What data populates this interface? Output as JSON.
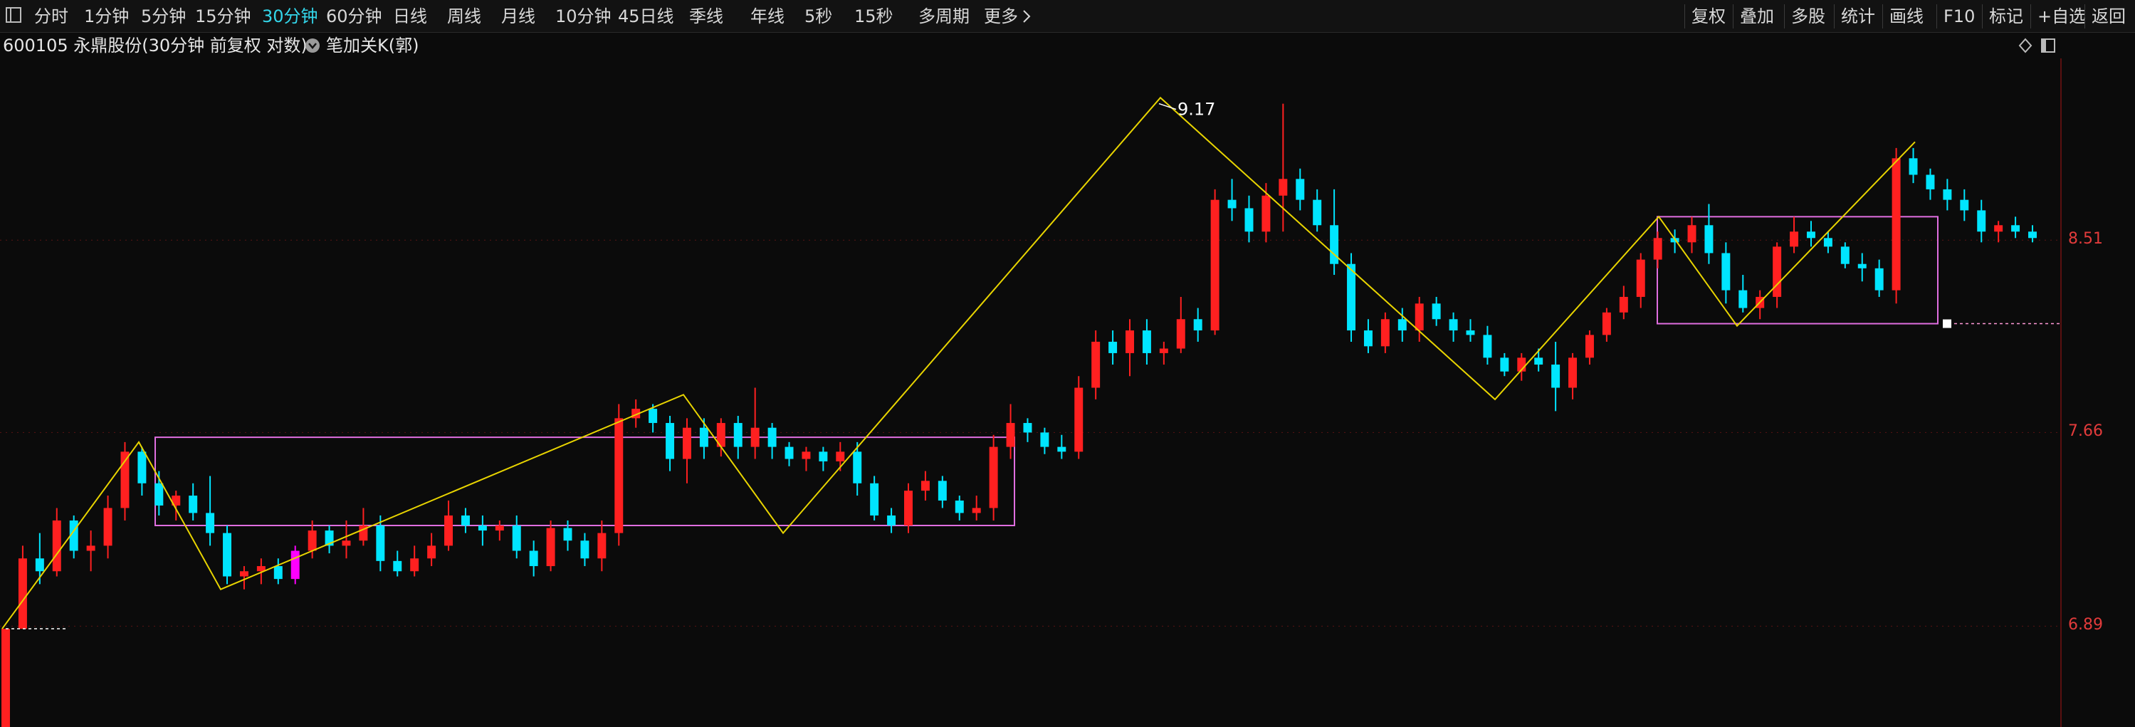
{
  "toolbar": {
    "left_items": [
      "分时",
      "1分钟",
      "5分钟",
      "15分钟",
      "30分钟",
      "60分钟",
      "日线",
      "周线",
      "月线",
      "10分钟",
      "45日线",
      "季线",
      "年线",
      "5秒",
      "15秒",
      "多周期",
      "更多"
    ],
    "active_index": 4,
    "more_chevron": "chevron-right-icon",
    "right_items": [
      "复权",
      "叠加",
      "多股",
      "统计",
      "画线",
      "F10",
      "标记",
      "+自选",
      "返回"
    ]
  },
  "infobar": {
    "stock_title": "600105 永鼎股份(30分钟 前复权 对数)",
    "indicator_label": "笔加关K(郭)",
    "indicator_icon": "chevron-down-circle-icon",
    "diamond_icon": "diamond-icon",
    "window_icon": "window-icon"
  },
  "colors": {
    "accent": "#33d6ea",
    "up": "#ff2020",
    "down": "#00e5ff",
    "stroke_line": "#e8d400",
    "pivot_box": "#e06ee0",
    "axis_label": "#e23b3b",
    "highlight": "#ff00ff"
  },
  "chart_data": {
    "type": "candlestick",
    "y_scale": "log",
    "ylim": [
      6.52,
      9.4
    ],
    "y_ticks": [
      {
        "label": "8.51",
        "value": 8.51
      },
      {
        "label": "7.66",
        "value": 7.66
      },
      {
        "label": "6.89",
        "value": 6.89
      }
    ],
    "peak_label": {
      "text": "9.17",
      "value": 9.17
    },
    "last_price": 8.13,
    "candles": [
      [
        6.5,
        6.88,
        6.5,
        6.88
      ],
      [
        6.88,
        7.2,
        6.88,
        7.15
      ],
      [
        7.15,
        7.25,
        7.05,
        7.1
      ],
      [
        7.1,
        7.35,
        7.08,
        7.3
      ],
      [
        7.3,
        7.32,
        7.15,
        7.18
      ],
      [
        7.18,
        7.26,
        7.1,
        7.2
      ],
      [
        7.2,
        7.4,
        7.15,
        7.35
      ],
      [
        7.35,
        7.62,
        7.3,
        7.58
      ],
      [
        7.58,
        7.6,
        7.4,
        7.45
      ],
      [
        7.45,
        7.5,
        7.32,
        7.36
      ],
      [
        7.36,
        7.42,
        7.3,
        7.4
      ],
      [
        7.4,
        7.45,
        7.3,
        7.33
      ],
      [
        7.33,
        7.48,
        7.2,
        7.25
      ],
      [
        7.25,
        7.28,
        7.05,
        7.08
      ],
      [
        7.08,
        7.12,
        7.03,
        7.1
      ],
      [
        7.1,
        7.15,
        7.05,
        7.12
      ],
      [
        7.12,
        7.15,
        7.05,
        7.07
      ],
      [
        7.07,
        7.2,
        7.05,
        7.18
      ],
      [
        7.18,
        7.3,
        7.15,
        7.26
      ],
      [
        7.26,
        7.28,
        7.17,
        7.2
      ],
      [
        7.2,
        7.3,
        7.15,
        7.22
      ],
      [
        7.22,
        7.35,
        7.2,
        7.28
      ],
      [
        7.28,
        7.32,
        7.1,
        7.14
      ],
      [
        7.14,
        7.18,
        7.08,
        7.1
      ],
      [
        7.1,
        7.2,
        7.08,
        7.15
      ],
      [
        7.15,
        7.25,
        7.12,
        7.2
      ],
      [
        7.2,
        7.38,
        7.18,
        7.32
      ],
      [
        7.32,
        7.35,
        7.25,
        7.28
      ],
      [
        7.28,
        7.32,
        7.2,
        7.26
      ],
      [
        7.26,
        7.3,
        7.22,
        7.28
      ],
      [
        7.28,
        7.32,
        7.15,
        7.18
      ],
      [
        7.18,
        7.22,
        7.08,
        7.12
      ],
      [
        7.12,
        7.3,
        7.1,
        7.27
      ],
      [
        7.27,
        7.3,
        7.18,
        7.22
      ],
      [
        7.22,
        7.25,
        7.12,
        7.15
      ],
      [
        7.15,
        7.3,
        7.1,
        7.25
      ],
      [
        7.25,
        7.78,
        7.2,
        7.72
      ],
      [
        7.72,
        7.8,
        7.68,
        7.76
      ],
      [
        7.76,
        7.78,
        7.66,
        7.7
      ],
      [
        7.7,
        7.73,
        7.5,
        7.55
      ],
      [
        7.55,
        7.72,
        7.45,
        7.68
      ],
      [
        7.68,
        7.72,
        7.55,
        7.6
      ],
      [
        7.6,
        7.72,
        7.56,
        7.7
      ],
      [
        7.7,
        7.73,
        7.55,
        7.6
      ],
      [
        7.6,
        7.85,
        7.55,
        7.68
      ],
      [
        7.68,
        7.7,
        7.55,
        7.6
      ],
      [
        7.6,
        7.62,
        7.52,
        7.55
      ],
      [
        7.55,
        7.6,
        7.5,
        7.58
      ],
      [
        7.58,
        7.6,
        7.5,
        7.54
      ],
      [
        7.54,
        7.62,
        7.5,
        7.58
      ],
      [
        7.58,
        7.62,
        7.4,
        7.45
      ],
      [
        7.45,
        7.48,
        7.3,
        7.32
      ],
      [
        7.32,
        7.35,
        7.25,
        7.28
      ],
      [
        7.28,
        7.45,
        7.25,
        7.42
      ],
      [
        7.42,
        7.5,
        7.38,
        7.46
      ],
      [
        7.46,
        7.48,
        7.35,
        7.38
      ],
      [
        7.38,
        7.4,
        7.3,
        7.33
      ],
      [
        7.33,
        7.4,
        7.3,
        7.35
      ],
      [
        7.35,
        7.65,
        7.3,
        7.6
      ],
      [
        7.6,
        7.78,
        7.55,
        7.7
      ],
      [
        7.7,
        7.72,
        7.62,
        7.66
      ],
      [
        7.66,
        7.68,
        7.57,
        7.6
      ],
      [
        7.6,
        7.65,
        7.55,
        7.58
      ],
      [
        7.58,
        7.9,
        7.55,
        7.85
      ],
      [
        7.85,
        8.1,
        7.8,
        8.05
      ],
      [
        8.05,
        8.1,
        7.95,
        8.0
      ],
      [
        8.0,
        8.15,
        7.9,
        8.1
      ],
      [
        8.1,
        8.15,
        7.95,
        8.0
      ],
      [
        8.0,
        8.05,
        7.95,
        8.02
      ],
      [
        8.02,
        8.25,
        8.0,
        8.15
      ],
      [
        8.15,
        8.2,
        8.05,
        8.1
      ],
      [
        8.1,
        8.75,
        8.08,
        8.7
      ],
      [
        8.7,
        8.8,
        8.6,
        8.66
      ],
      [
        8.66,
        8.72,
        8.5,
        8.55
      ],
      [
        8.55,
        8.78,
        8.5,
        8.72
      ],
      [
        8.72,
        9.17,
        8.55,
        8.8
      ],
      [
        8.8,
        8.85,
        8.65,
        8.7
      ],
      [
        8.7,
        8.75,
        8.55,
        8.58
      ],
      [
        8.58,
        8.75,
        8.35,
        8.4
      ],
      [
        8.4,
        8.45,
        8.05,
        8.1
      ],
      [
        8.1,
        8.15,
        8.0,
        8.03
      ],
      [
        8.03,
        8.18,
        8.0,
        8.15
      ],
      [
        8.15,
        8.2,
        8.05,
        8.1
      ],
      [
        8.1,
        8.25,
        8.05,
        8.22
      ],
      [
        8.22,
        8.25,
        8.12,
        8.15
      ],
      [
        8.15,
        8.18,
        8.05,
        8.1
      ],
      [
        8.1,
        8.15,
        8.05,
        8.08
      ],
      [
        8.08,
        8.12,
        7.95,
        7.98
      ],
      [
        7.98,
        8.0,
        7.9,
        7.92
      ],
      [
        7.92,
        8.0,
        7.88,
        7.98
      ],
      [
        7.98,
        8.02,
        7.92,
        7.95
      ],
      [
        7.95,
        8.05,
        7.75,
        7.85
      ],
      [
        7.85,
        8.0,
        7.8,
        7.98
      ],
      [
        7.98,
        8.1,
        7.95,
        8.08
      ],
      [
        8.08,
        8.2,
        8.05,
        8.18
      ],
      [
        8.18,
        8.3,
        8.15,
        8.25
      ],
      [
        8.25,
        8.45,
        8.2,
        8.42
      ],
      [
        8.42,
        8.55,
        8.38,
        8.52
      ],
      [
        8.52,
        8.56,
        8.45,
        8.5
      ],
      [
        8.5,
        8.62,
        8.45,
        8.58
      ],
      [
        8.58,
        8.68,
        8.4,
        8.45
      ],
      [
        8.45,
        8.5,
        8.22,
        8.28
      ],
      [
        8.28,
        8.35,
        8.18,
        8.2
      ],
      [
        8.2,
        8.28,
        8.15,
        8.25
      ],
      [
        8.25,
        8.5,
        8.2,
        8.48
      ],
      [
        8.48,
        8.62,
        8.45,
        8.55
      ],
      [
        8.55,
        8.6,
        8.48,
        8.52
      ],
      [
        8.52,
        8.55,
        8.45,
        8.48
      ],
      [
        8.48,
        8.5,
        8.38,
        8.4
      ],
      [
        8.4,
        8.45,
        8.32,
        8.38
      ],
      [
        8.38,
        8.42,
        8.25,
        8.28
      ],
      [
        8.28,
        8.95,
        8.22,
        8.9
      ],
      [
        8.9,
        8.95,
        8.78,
        8.82
      ],
      [
        8.82,
        8.85,
        8.7,
        8.75
      ],
      [
        8.75,
        8.8,
        8.65,
        8.7
      ],
      [
        8.7,
        8.75,
        8.6,
        8.65
      ],
      [
        8.65,
        8.7,
        8.5,
        8.55
      ],
      [
        8.55,
        8.6,
        8.5,
        8.58
      ],
      [
        8.58,
        8.62,
        8.52,
        8.55
      ],
      [
        8.55,
        8.58,
        8.5,
        8.52
      ]
    ],
    "highlight_candle_index": 17,
    "stroke_pivots": [
      {
        "x": 3,
        "y": 6.88
      },
      {
        "x": 195,
        "y": 7.62
      },
      {
        "x": 310,
        "y": 7.03
      },
      {
        "x": 960,
        "y": 7.82
      },
      {
        "x": 1100,
        "y": 7.25
      },
      {
        "x": 1630,
        "y": 9.2
      },
      {
        "x": 2100,
        "y": 7.8
      },
      {
        "x": 2330,
        "y": 8.62
      },
      {
        "x": 2440,
        "y": 8.12
      },
      {
        "x": 2690,
        "y": 8.98
      }
    ],
    "pivot_boxes": [
      {
        "x0": 218,
        "x1": 1425,
        "ytop": 7.64,
        "ybot": 7.28
      },
      {
        "x0": 2328,
        "x1": 2722,
        "ytop": 8.62,
        "ybot": 8.13
      }
    ]
  }
}
